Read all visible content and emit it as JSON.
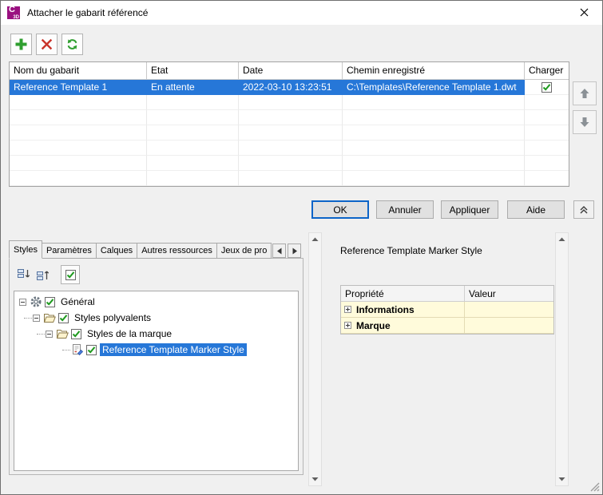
{
  "window": {
    "title": "Attacher le gabarit référencé"
  },
  "app_icon": {
    "letter": "C",
    "sub": "3D"
  },
  "template_table": {
    "columns": [
      "Nom du gabarit",
      "Etat",
      "Date",
      "Chemin enregistré",
      "Charger"
    ],
    "rows": [
      {
        "name": "Reference Template 1",
        "state": "En attente",
        "date": "2022-03-10 13:23:51",
        "path": "C:\\Templates\\Reference Template 1.dwt",
        "load_checked": true,
        "selected": true
      }
    ],
    "empty_row_count": 6
  },
  "dialog_buttons": {
    "ok": "OK",
    "cancel": "Annuler",
    "apply": "Appliquer",
    "help": "Aide"
  },
  "tabs": [
    {
      "label": "Styles",
      "active": true
    },
    {
      "label": "Paramètres",
      "active": false
    },
    {
      "label": "Calques",
      "active": false
    },
    {
      "label": "Autres ressources",
      "active": false
    },
    {
      "label": "Jeux de pro",
      "active": false
    }
  ],
  "styles_tree": [
    {
      "label": "Général",
      "level": 0,
      "icon": "gear",
      "checked": true,
      "expanded": true
    },
    {
      "label": "Styles polyvalents",
      "level": 1,
      "icon": "open-folder",
      "checked": true,
      "expanded": true
    },
    {
      "label": "Styles de la marque",
      "level": 2,
      "icon": "open-folder",
      "checked": true,
      "expanded": true
    },
    {
      "label": "Reference Template Marker Style",
      "level": 3,
      "icon": "marker-style",
      "checked": true,
      "selected": true
    }
  ],
  "properties_panel": {
    "title": "Reference Template Marker Style",
    "columns": {
      "property": "Propriété",
      "value": "Valeur"
    },
    "rows": [
      {
        "property": "Informations",
        "value": ""
      },
      {
        "property": "Marque",
        "value": ""
      }
    ]
  },
  "colors": {
    "selection_blue": "#2677d8",
    "check_green": "#1f9a1f",
    "add_green": "#2f9e2f",
    "delete_red": "#c9342a",
    "property_row_yellow": "#fffbdb",
    "app_icon_magenta": "#9a1080"
  },
  "icons": {
    "app": "civil3d-c-badge",
    "close": "thin-x",
    "add": "green-plus",
    "delete": "red-x",
    "refresh": "green-circular-arrows",
    "move_up": "gray-up-arrow",
    "move_down": "gray-down-arrow",
    "collapse_panel": "double-chevron-up",
    "tab_scroll_left": "left-triangle",
    "tab_scroll_right": "right-triangle",
    "general_node": "gear",
    "category_node": "open-folder",
    "style_node": "page-with-marker",
    "checkbox_checked": "green-check",
    "expand_open": "minus-box",
    "expand_closed": "plus-box",
    "scroll_up": "small-up-triangle",
    "scroll_down": "small-down-triangle",
    "resize": "diagonal-grip"
  }
}
